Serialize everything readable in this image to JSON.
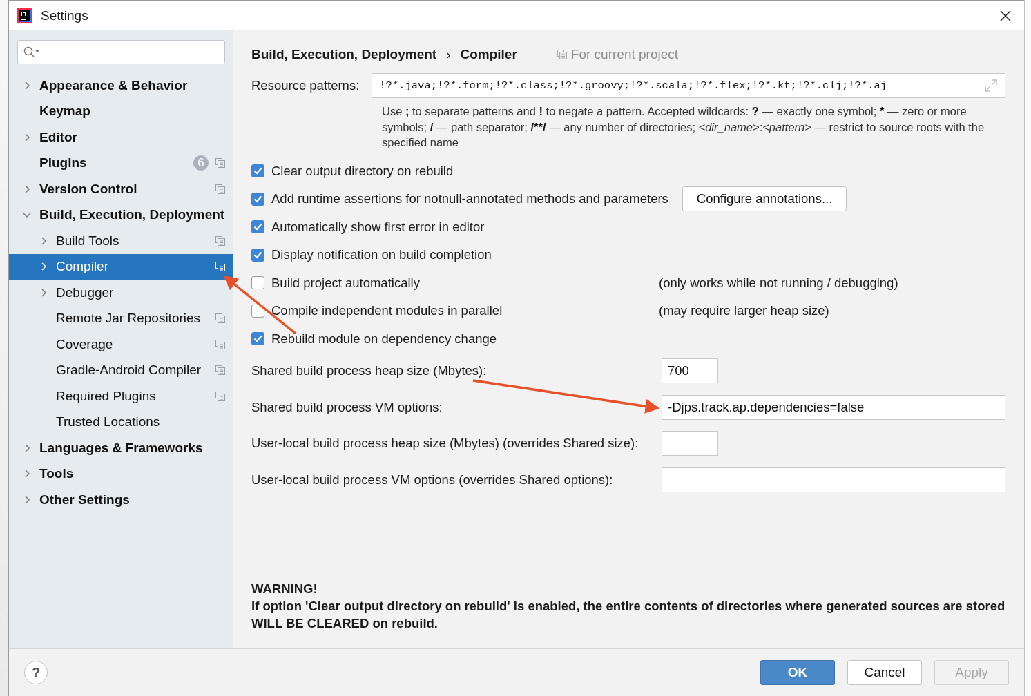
{
  "window": {
    "title": "Settings"
  },
  "sidebar": {
    "items": [
      {
        "label": "Appearance & Behavior",
        "expanded": false,
        "selected": false,
        "project_scoped": false
      },
      {
        "label": "Keymap",
        "selected": false,
        "project_scoped": false
      },
      {
        "label": "Editor",
        "expanded": false,
        "selected": false,
        "project_scoped": false
      },
      {
        "label": "Plugins",
        "selected": false,
        "project_scoped": true,
        "badge": "6"
      },
      {
        "label": "Version Control",
        "expanded": false,
        "selected": false,
        "project_scoped": true
      },
      {
        "label": "Build, Execution, Deployment",
        "expanded": true,
        "selected": false,
        "project_scoped": false,
        "children": [
          {
            "label": "Build Tools",
            "expanded": false,
            "selected": false,
            "project_scoped": true
          },
          {
            "label": "Compiler",
            "expanded": false,
            "selected": true,
            "project_scoped": true
          },
          {
            "label": "Debugger",
            "expanded": false,
            "selected": false,
            "project_scoped": false
          },
          {
            "label": "Remote Jar Repositories",
            "selected": false,
            "project_scoped": true
          },
          {
            "label": "Coverage",
            "selected": false,
            "project_scoped": true
          },
          {
            "label": "Gradle-Android Compiler",
            "selected": false,
            "project_scoped": true
          },
          {
            "label": "Required Plugins",
            "selected": false,
            "project_scoped": true
          },
          {
            "label": "Trusted Locations",
            "selected": false,
            "project_scoped": false
          }
        ]
      },
      {
        "label": "Languages & Frameworks",
        "expanded": false,
        "selected": false,
        "project_scoped": false
      },
      {
        "label": "Tools",
        "expanded": false,
        "selected": false,
        "project_scoped": false
      },
      {
        "label": "Other Settings",
        "expanded": false,
        "selected": false,
        "project_scoped": false
      }
    ]
  },
  "breadcrumb": {
    "parts": [
      "Build, Execution, Deployment",
      "Compiler"
    ],
    "separator": "›",
    "scope": "For current project"
  },
  "resource_patterns": {
    "label": "Resource patterns:",
    "value": "!?*.java;!?*.form;!?*.class;!?*.groovy;!?*.scala;!?*.flex;!?*.kt;!?*.clj;!?*.aj",
    "help": [
      {
        "text": "Use ",
        "kind": "plain"
      },
      {
        "text": ";",
        "kind": "bold"
      },
      {
        "text": " to separate patterns and ",
        "kind": "plain"
      },
      {
        "text": "!",
        "kind": "bold"
      },
      {
        "text": " to negate a pattern. Accepted wildcards: ",
        "kind": "plain"
      },
      {
        "text": "?",
        "kind": "bold"
      },
      {
        "text": " — exactly one symbol; ",
        "kind": "plain"
      },
      {
        "text": "*",
        "kind": "bold"
      },
      {
        "text": " — zero or more symbols; ",
        "kind": "plain"
      },
      {
        "text": "/",
        "kind": "bold"
      },
      {
        "text": " — path separator; ",
        "kind": "plain"
      },
      {
        "text": "/**/",
        "kind": "bold"
      },
      {
        "text": " — any number of directories; ",
        "kind": "plain"
      },
      {
        "text": "<dir_name>",
        "kind": "italic"
      },
      {
        "text": ":",
        "kind": "plain"
      },
      {
        "text": "<pattern>",
        "kind": "italic"
      },
      {
        "text": " — restrict to source roots with the specified name",
        "kind": "plain"
      }
    ]
  },
  "options": [
    {
      "label": "Clear output directory on rebuild",
      "checked": true
    },
    {
      "label": "Add runtime assertions for notnull-annotated methods and parameters",
      "checked": true,
      "button": "Configure annotations..."
    },
    {
      "label": "Automatically show first error in editor",
      "checked": true
    },
    {
      "label": "Display notification on build completion",
      "checked": true
    },
    {
      "label": "Build project automatically",
      "checked": false,
      "note": "(only works while not running / debugging)"
    },
    {
      "label": "Compile independent modules in parallel",
      "checked": false,
      "note": "(may require larger heap size)"
    },
    {
      "label": "Rebuild module on dependency change",
      "checked": true
    }
  ],
  "fields": [
    {
      "label": "Shared build process heap size (Mbytes):",
      "value": "700",
      "kind": "short"
    },
    {
      "label": "Shared build process VM options:",
      "value": "-Djps.track.ap.dependencies=false",
      "kind": "wide"
    },
    {
      "label": "User-local build process heap size (Mbytes) (overrides Shared size):",
      "kind": "short"
    },
    {
      "label": "User-local build process VM options (overrides Shared options):",
      "kind": "wide"
    }
  ],
  "warning": {
    "title": "WARNING!",
    "text": "If option 'Clear output directory on rebuild' is enabled, the entire contents of directories where generated sources are stored WILL BE CLEARED on rebuild."
  },
  "footer": {
    "help": "?",
    "buttons": [
      {
        "label": "OK",
        "kind": "default",
        "disabled": false
      },
      {
        "label": "Cancel",
        "kind": "normal",
        "disabled": false
      },
      {
        "label": "Apply",
        "kind": "normal",
        "disabled": true
      }
    ]
  }
}
